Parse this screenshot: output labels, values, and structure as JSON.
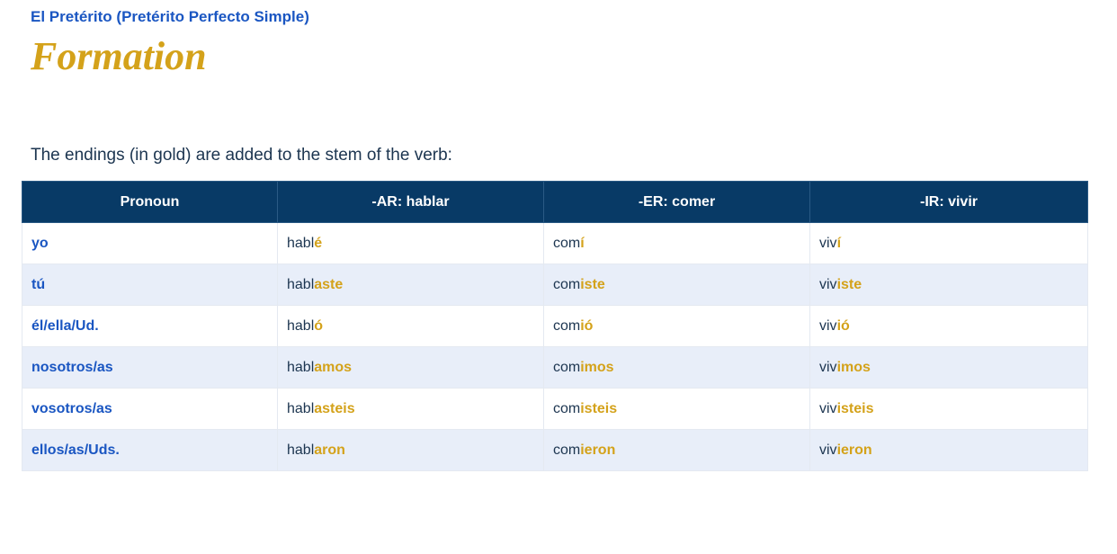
{
  "header": {
    "subtitle": "El Pretérito (Pretérito Perfecto Simple)",
    "title": "Formation"
  },
  "intro_text": "The endings (in gold) are added to the stem of the verb:",
  "colors": {
    "heading_blue": "#1a56c2",
    "gold": "#d4a21a",
    "table_header_bg": "#083a66",
    "alt_row_bg": "#e8eef9",
    "text_dark": "#1c3550"
  },
  "table": {
    "headers": [
      "Pronoun",
      "-AR: hablar",
      "-ER: comer",
      "-IR: vivir"
    ],
    "rows": [
      {
        "pronoun": "yo",
        "ar": {
          "stem": "habl",
          "ending": "é"
        },
        "er": {
          "stem": "com",
          "ending": "í"
        },
        "ir": {
          "stem": "viv",
          "ending": "í"
        }
      },
      {
        "pronoun": "tú",
        "ar": {
          "stem": "habl",
          "ending": "aste"
        },
        "er": {
          "stem": "com",
          "ending": "iste"
        },
        "ir": {
          "stem": "viv",
          "ending": "iste"
        }
      },
      {
        "pronoun": "él/ella/Ud.",
        "ar": {
          "stem": "habl",
          "ending": "ó"
        },
        "er": {
          "stem": "com",
          "ending": "ió"
        },
        "ir": {
          "stem": "viv",
          "ending": "ió"
        }
      },
      {
        "pronoun": "nosotros/as",
        "ar": {
          "stem": "habl",
          "ending": "amos"
        },
        "er": {
          "stem": "com",
          "ending": "imos"
        },
        "ir": {
          "stem": "viv",
          "ending": "imos"
        }
      },
      {
        "pronoun": "vosotros/as",
        "ar": {
          "stem": "habl",
          "ending": "asteis"
        },
        "er": {
          "stem": "com",
          "ending": "isteis"
        },
        "ir": {
          "stem": "viv",
          "ending": "isteis"
        }
      },
      {
        "pronoun": "ellos/as/Uds.",
        "ar": {
          "stem": "habl",
          "ending": "aron"
        },
        "er": {
          "stem": "com",
          "ending": "ieron"
        },
        "ir": {
          "stem": "viv",
          "ending": "ieron"
        }
      }
    ]
  }
}
